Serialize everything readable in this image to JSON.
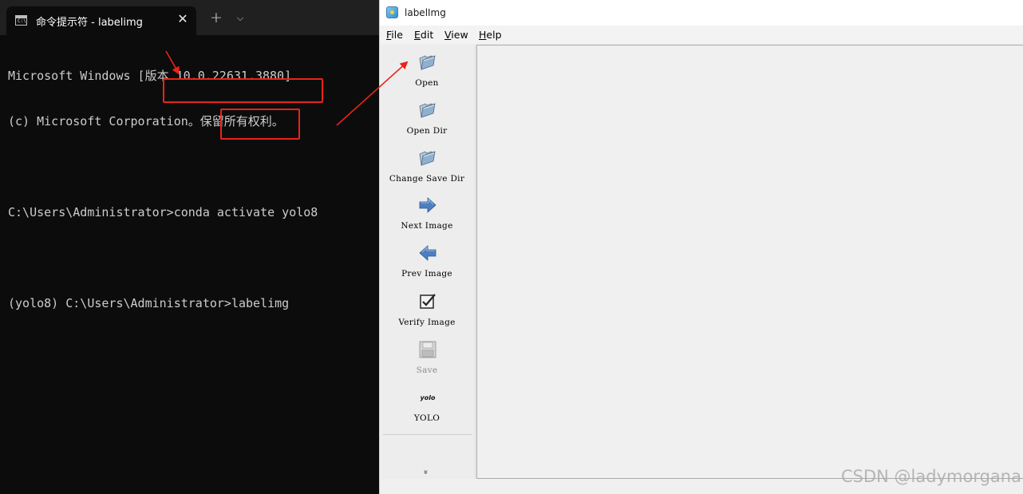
{
  "terminal": {
    "tab_title": "命令提示符 - labelimg",
    "tab_icon_text": "C:\\",
    "close_glyph": "✕",
    "new_tab_glyph": "+",
    "dropdown_glyph": "⌵",
    "lines": [
      "Microsoft Windows [版本 10.0.22631.3880]",
      "(c) Microsoft Corporation。保留所有权利。",
      "",
      "C:\\Users\\Administrator>conda activate yolo8",
      "",
      "(yolo8) C:\\Users\\Administrator>labelimg"
    ]
  },
  "labelimg": {
    "title": "labelImg",
    "menu": [
      {
        "key": "F",
        "rest": "ile"
      },
      {
        "key": "E",
        "rest": "dit"
      },
      {
        "key": "V",
        "rest": "iew"
      },
      {
        "key": "H",
        "rest": "elp"
      }
    ],
    "tools": [
      {
        "label": "Open",
        "icon": "folder-open-icon",
        "enabled": true
      },
      {
        "label": "Open Dir",
        "icon": "folder-open-icon",
        "enabled": true
      },
      {
        "label": "Change Save Dir",
        "icon": "folder-open-icon",
        "enabled": true
      },
      {
        "label": "Next Image",
        "icon": "arrow-right-icon",
        "enabled": true
      },
      {
        "label": "Prev Image",
        "icon": "arrow-left-icon",
        "enabled": true
      },
      {
        "label": "Verify Image",
        "icon": "checkbox-icon",
        "enabled": true
      },
      {
        "label": "Save",
        "icon": "floppy-disk-icon",
        "enabled": false
      },
      {
        "label": "YOLO",
        "icon": "yolo-format-icon",
        "icon_text": "yolo",
        "enabled": true
      }
    ],
    "more_glyph": "»"
  },
  "watermark": "CSDN @ladymorgana",
  "colors": {
    "terminal_bg": "#0c0c0c",
    "terminal_text": "#cccccc",
    "highlight_red": "#e8241a",
    "window_bg": "#f0f0f0"
  }
}
